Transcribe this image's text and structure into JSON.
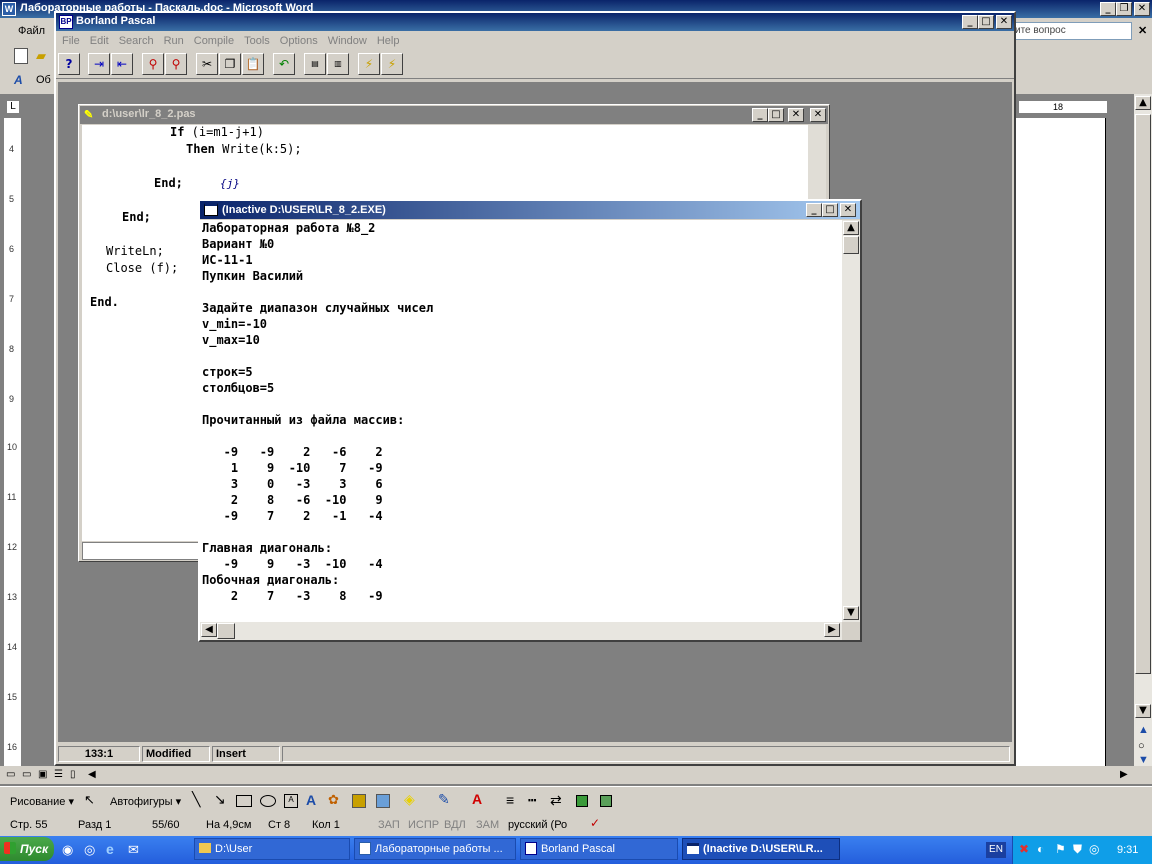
{
  "word": {
    "title": "Лабораторные работы - Паскаль.doc - Microsoft Word",
    "menu_file": "Файл",
    "help_hint": "ите вопрос",
    "style_box": "Об",
    "zoom_value": "18"
  },
  "bp": {
    "title": "Borland Pascal",
    "menu": [
      "File",
      "Edit",
      "Search",
      "Run",
      "Compile",
      "Tools",
      "Options",
      "Window",
      "Help"
    ],
    "status": {
      "position": "133:1",
      "modified": "Modified",
      "insert": "Insert"
    }
  },
  "editor": {
    "title": "d:\\user\\lr_8_2.pas",
    "lines": [
      {
        "kw": "If",
        "rest": " (i=m1-j+1)",
        "indent": 88
      },
      {
        "kw": "Then",
        "rest": " Write(k:5);",
        "indent": 104
      },
      {
        "kw": "",
        "rest": "",
        "indent": 0
      },
      {
        "kw": "End;",
        "rest": "",
        "indent": 72,
        "comment": "{j}"
      },
      {
        "kw": "",
        "rest": "",
        "indent": 0
      },
      {
        "kw": "End;",
        "rest": "",
        "indent": 40
      },
      {
        "kw": "",
        "rest": "",
        "indent": 0
      },
      {
        "kw": "",
        "rest": "WriteLn;",
        "indent": 24
      },
      {
        "kw": "",
        "rest": "Close (f);",
        "indent": 24
      },
      {
        "kw": "",
        "rest": "",
        "indent": 0
      },
      {
        "kw": "End.",
        "rest": "",
        "indent": 8
      }
    ]
  },
  "console": {
    "title": "(Inactive D:\\USER\\LR_8_2.EXE)",
    "lines": [
      "Лабораторная работа №8_2",
      "Вариант №0",
      "ИС-11-1",
      "Пупкин Василий",
      "",
      "Задайте диапазон случайных чисел",
      "v_min=-10",
      "v_max=10",
      "",
      "строк=5",
      "столбцов=5",
      "",
      "Прочитанный из файла массив:",
      "",
      "   -9   -9    2   -6    2",
      "    1    9  -10    7   -9",
      "    3    0   -3    3    6",
      "    2    8   -6  -10    9",
      "   -9    7    2   -1   -4",
      "",
      "Главная диагональ:",
      "   -9    9   -3  -10   -4",
      "Побочная диагональ:",
      "    2    7   -3    8   -9"
    ]
  },
  "drawing": {
    "draw_label": "Рисование ▾",
    "autoshapes_label": "Автофигуры ▾"
  },
  "word_status": {
    "page": "Стр. 55",
    "section": "Разд 1",
    "pages": "55/60",
    "at": "На 4,9см",
    "line": "Ст 8",
    "col": "Кол 1",
    "rec": "ЗАП",
    "trk": "ИСПР",
    "ext": "ВДЛ",
    "ovr": "ЗАМ",
    "lang": "русский (Ро"
  },
  "taskbar": {
    "start": "Пуск",
    "items": [
      "D:\\User",
      "Лабораторные работы ...",
      "Borland Pascal",
      "(Inactive D:\\USER\\LR..."
    ],
    "lang": "EN",
    "clock": "9:31"
  },
  "ruler_numbers": [
    "4",
    "5",
    "6",
    "7",
    "8",
    "9",
    "10",
    "11",
    "12",
    "13",
    "14",
    "15",
    "16"
  ]
}
